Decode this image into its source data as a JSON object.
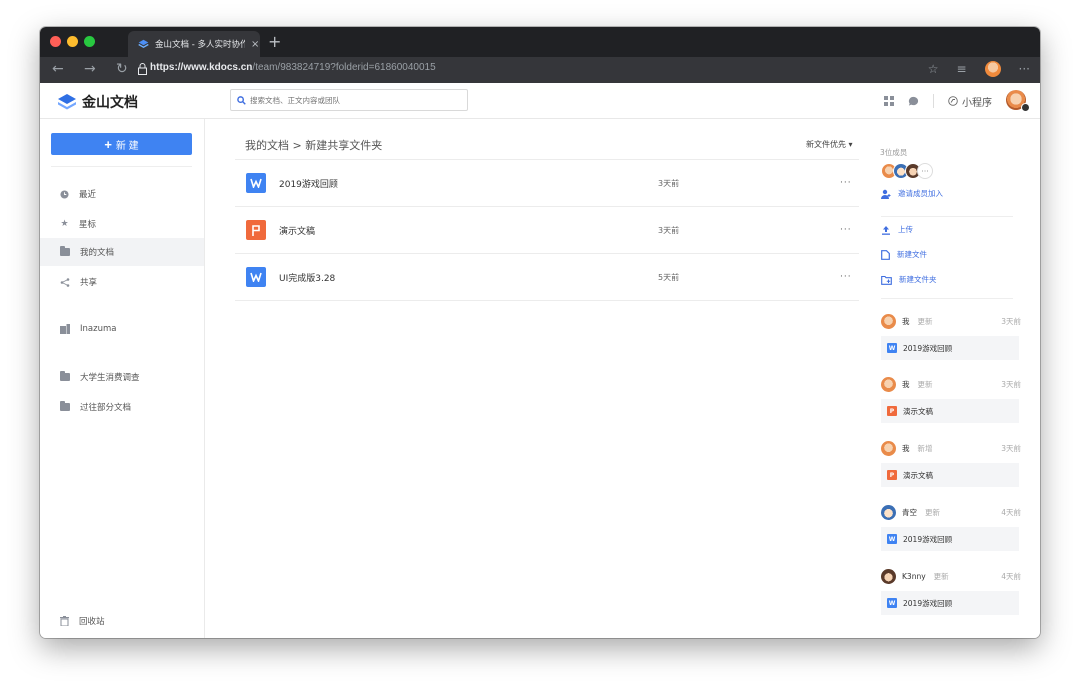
{
  "browser": {
    "tab_title": "金山文档 - 多人实时协作的在线",
    "tab_close": "×",
    "new_tab": "+",
    "url_bold": "https://www.kdocs.cn",
    "url_rest": "/team/983824719?folderid=61860040015",
    "traffic_lights": [
      "#ff5f57",
      "#febc2e",
      "#28c840"
    ]
  },
  "header": {
    "logo_text": "金山文档",
    "search_placeholder": "搜索文档、正文内容或团队",
    "mini_program": "小程序"
  },
  "sidebar": {
    "new_button": "新 建",
    "items": [
      {
        "label": "最近",
        "icon": "clock-icon"
      },
      {
        "label": "星标",
        "icon": "star-icon"
      },
      {
        "label": "我的文档",
        "icon": "folder-icon"
      },
      {
        "label": "共享",
        "icon": "share-icon"
      },
      {
        "label": "Inazuma",
        "icon": "team-icon"
      },
      {
        "label": "大学生消费调查",
        "icon": "folder-icon"
      },
      {
        "label": "过往部分文档",
        "icon": "folder-icon"
      }
    ],
    "trash": "回收站"
  },
  "main": {
    "breadcrumb": "我的文档 > 新建共享文件夹",
    "sort": "新文件优先 ▾",
    "files": [
      {
        "name": "2019游戏回顾",
        "type": "W",
        "color": "#3f83f2",
        "time": "3天前",
        "more": "···"
      },
      {
        "name": "演示文稿",
        "type": "P",
        "color": "#f06a3c",
        "time": "3天前",
        "more": "···"
      },
      {
        "name": "UI完成版3.28",
        "type": "W",
        "color": "#3f83f2",
        "time": "5天前",
        "more": "···"
      }
    ]
  },
  "panel": {
    "members_title": "3位成员",
    "more_members": "···",
    "invite": "邀请成员加入",
    "upload": "上传",
    "new_file": "新建文件",
    "new_folder": "新建文件夹",
    "feed": [
      {
        "user": "我",
        "action": "更新",
        "time": "3天前",
        "file": "2019游戏回顾",
        "ftype": "W",
        "fcolor": "#3f83f2"
      },
      {
        "user": "我",
        "action": "更新",
        "time": "3天前",
        "file": "演示文稿",
        "ftype": "P",
        "fcolor": "#f06a3c"
      },
      {
        "user": "我",
        "action": "新增",
        "time": "3天前",
        "file": "演示文稿",
        "ftype": "P",
        "fcolor": "#f06a3c"
      },
      {
        "user": "青空",
        "action": "更新",
        "time": "4天前",
        "file": "2019游戏回顾",
        "ftype": "W",
        "fcolor": "#3f83f2"
      },
      {
        "user": "K3nny",
        "action": "更新",
        "time": "4天前",
        "file": "2019游戏回顾",
        "ftype": "W",
        "fcolor": "#3f83f2"
      }
    ]
  }
}
